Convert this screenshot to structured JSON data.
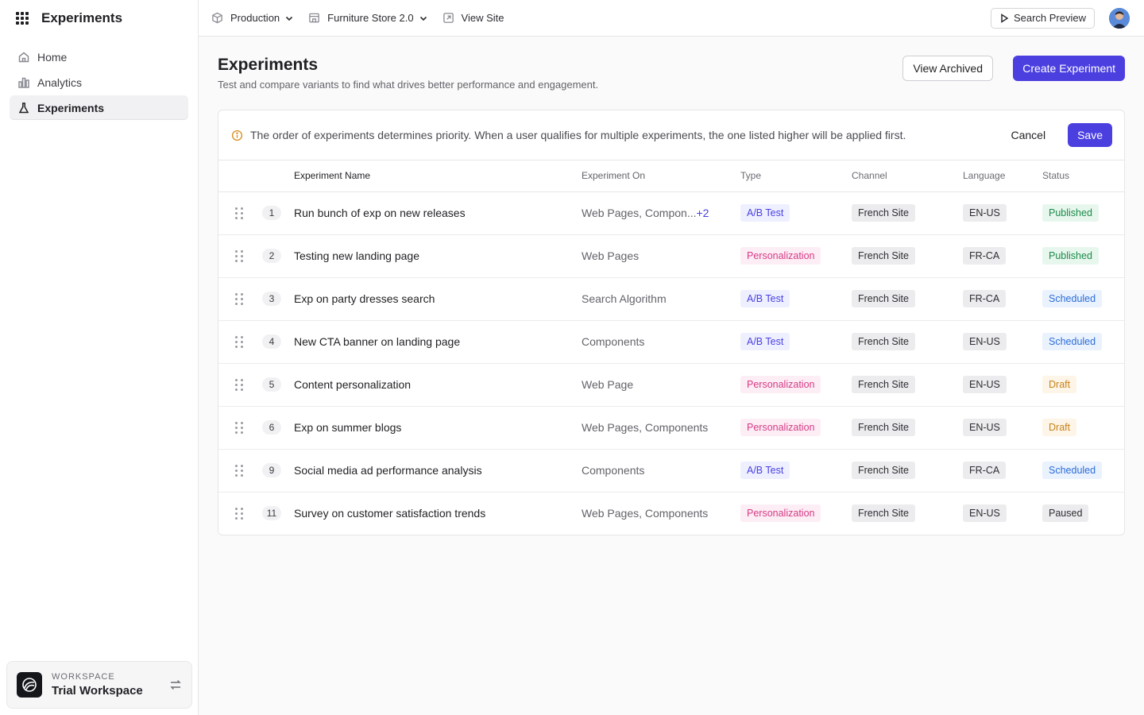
{
  "sidebar": {
    "title": "Experiments",
    "items": [
      {
        "label": "Home"
      },
      {
        "label": "Analytics"
      },
      {
        "label": "Experiments"
      }
    ],
    "workspace": {
      "label": "WORKSPACE",
      "name": "Trial Workspace"
    }
  },
  "topbar": {
    "environment": "Production",
    "site": "Furniture Store 2.0",
    "view_site": "View Site",
    "search_preview": "Search Preview"
  },
  "page": {
    "title": "Experiments",
    "subtitle": "Test and compare variants to find what drives better performance and engagement.",
    "view_archived": "View Archived",
    "create": "Create Experiment"
  },
  "notice": {
    "text": "The order of experiments determines priority. When a user qualifies for multiple experiments, the one listed higher will be applied first.",
    "cancel": "Cancel",
    "save": "Save"
  },
  "table": {
    "headers": [
      "Experiment Name",
      "Experiment On",
      "Type",
      "Channel",
      "Language",
      "Status"
    ],
    "rows": [
      {
        "num": "1",
        "name": "Run bunch of exp on new releases",
        "on": "Web Pages, Compon...",
        "more": "+2",
        "type": "A/B Test",
        "channel": "French Site",
        "language": "EN-US",
        "status": "Published"
      },
      {
        "num": "2",
        "name": "Testing new landing page",
        "on": "Web Pages",
        "more": "",
        "type": "Personalization",
        "channel": "French Site",
        "language": "FR-CA",
        "status": "Published"
      },
      {
        "num": "3",
        "name": "Exp on party dresses search",
        "on": "Search Algorithm",
        "more": "",
        "type": "A/B Test",
        "channel": "French Site",
        "language": "FR-CA",
        "status": "Scheduled"
      },
      {
        "num": "4",
        "name": "New CTA banner on landing page",
        "on": "Components",
        "more": "",
        "type": "A/B Test",
        "channel": "French Site",
        "language": "EN-US",
        "status": "Scheduled"
      },
      {
        "num": "5",
        "name": "Content personalization",
        "on": "Web Page",
        "more": "",
        "type": "Personalization",
        "channel": "French Site",
        "language": "EN-US",
        "status": "Draft"
      },
      {
        "num": "6",
        "name": "Exp on summer blogs",
        "on": "Web Pages, Components",
        "more": "",
        "type": "Personalization",
        "channel": "French Site",
        "language": "EN-US",
        "status": "Draft"
      },
      {
        "num": "9",
        "name": "Social media ad performance analysis",
        "on": "Components",
        "more": "",
        "type": "A/B Test",
        "channel": "French Site",
        "language": "FR-CA",
        "status": "Scheduled"
      },
      {
        "num": "11",
        "name": "Survey on customer satisfaction trends",
        "on": "Web Pages, Components",
        "more": "",
        "type": "Personalization",
        "channel": "French Site",
        "language": "EN-US",
        "status": "Paused"
      }
    ]
  },
  "colors": {
    "accent": "#4b3fe0"
  }
}
